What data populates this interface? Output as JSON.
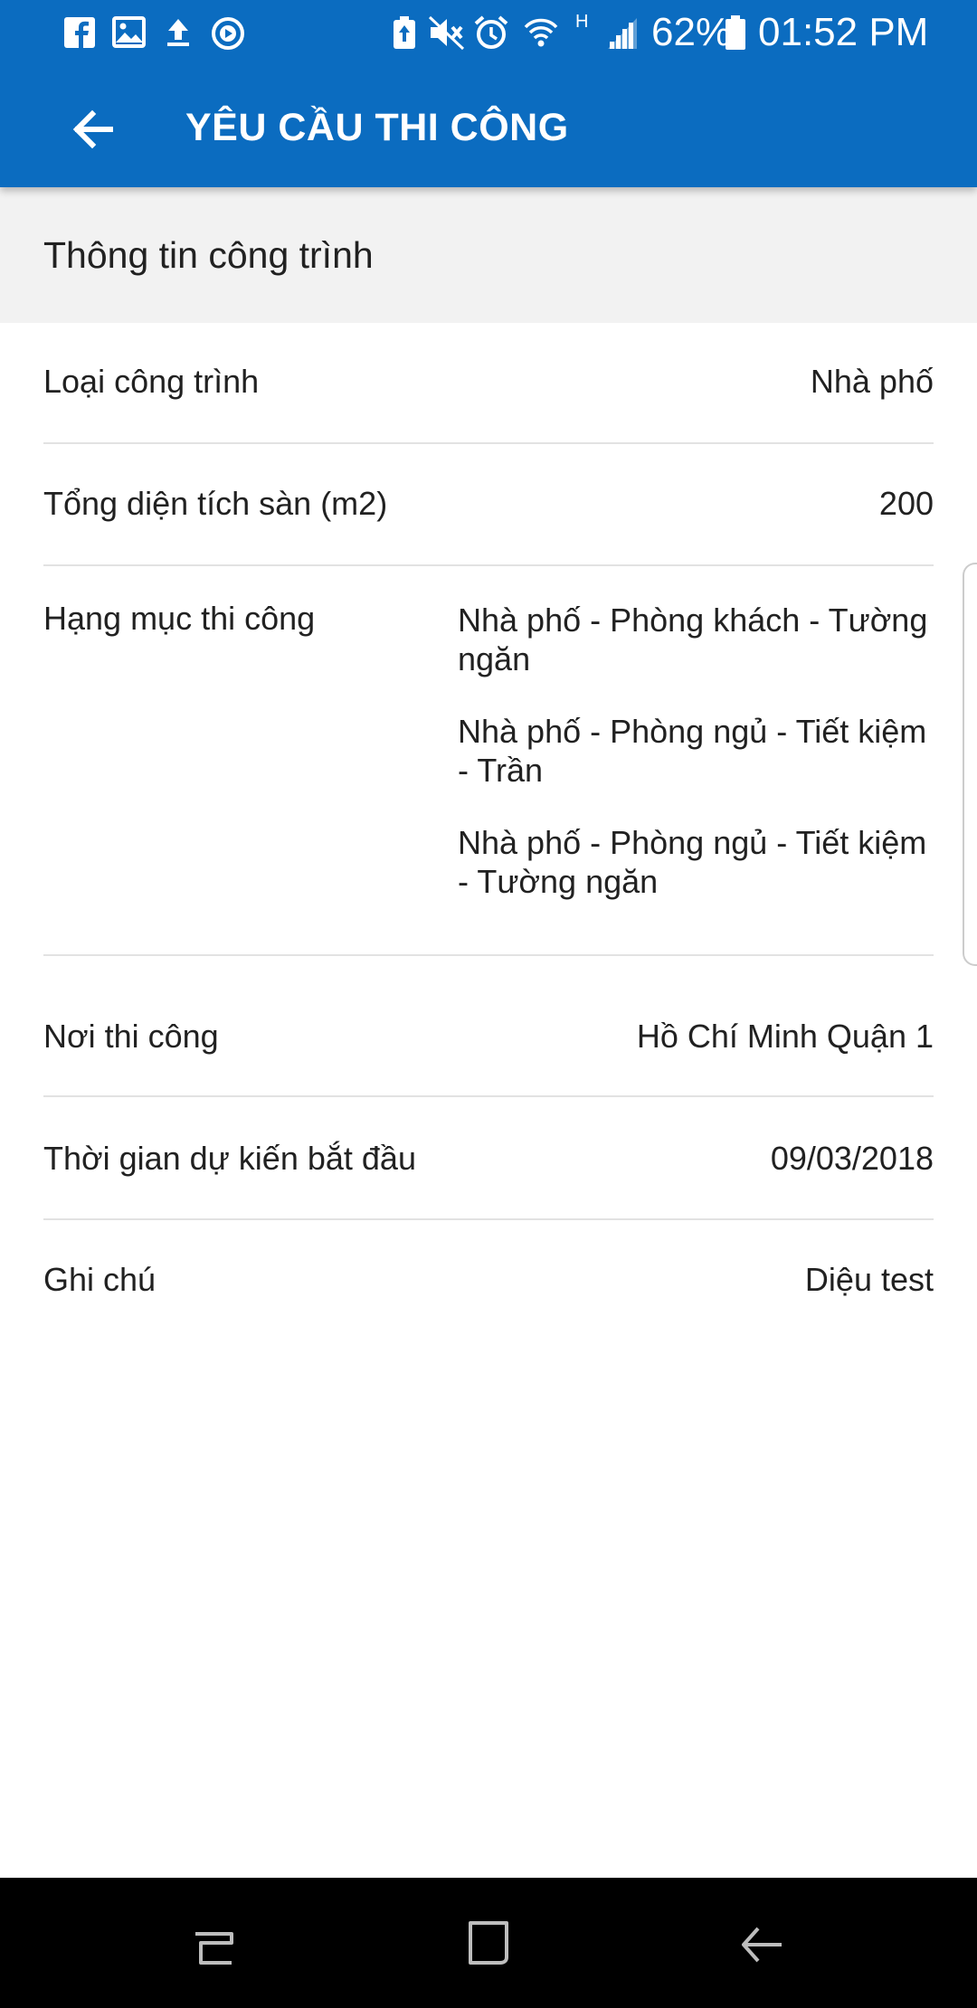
{
  "status_bar": {
    "left_icons": [
      "facebook-icon",
      "gallery-icon",
      "upload-icon",
      "headset-icon"
    ],
    "right_icons": [
      "battery-saver-icon",
      "mute-icon",
      "alarm-icon",
      "wifi-icon",
      "signal-icon",
      "battery-icon"
    ],
    "network_type": "H",
    "battery": "62%",
    "time": "01:52 PM"
  },
  "toolbar": {
    "back_icon": "arrow-left-icon",
    "title": "YÊU CẦU THI CÔNG"
  },
  "section": {
    "title": "Thông tin công trình"
  },
  "details": {
    "project_type": {
      "label": "Loại công trình",
      "value": "Nhà phố"
    },
    "floor_area": {
      "label": "Tổng diện tích sàn (m2)",
      "value": "200"
    },
    "work_items": {
      "label": "Hạng mục thi công",
      "values": [
        "Nhà phố - Phòng khách - Tường ngăn",
        "Nhà phố - Phòng ngủ - Tiết kiệm - Trần",
        "Nhà phố - Phòng ngủ - Tiết kiệm - Tường ngăn"
      ]
    },
    "location": {
      "label": "Nơi thi công",
      "value": "Hồ Chí Minh Quận 1"
    },
    "start_date": {
      "label": "Thời gian dự kiến bắt đầu",
      "value": "09/03/2018"
    },
    "note": {
      "label": "Ghi chú",
      "value": "Diệu test"
    }
  },
  "nav_bar": {
    "buttons": [
      "recent-apps-icon",
      "home-icon",
      "back-icon"
    ]
  },
  "colors": {
    "primary": "#0b6cc0",
    "section_bg": "#f2f2f2",
    "divider": "#e2e2e2",
    "text": "#212121",
    "nav_bg": "#000000"
  }
}
